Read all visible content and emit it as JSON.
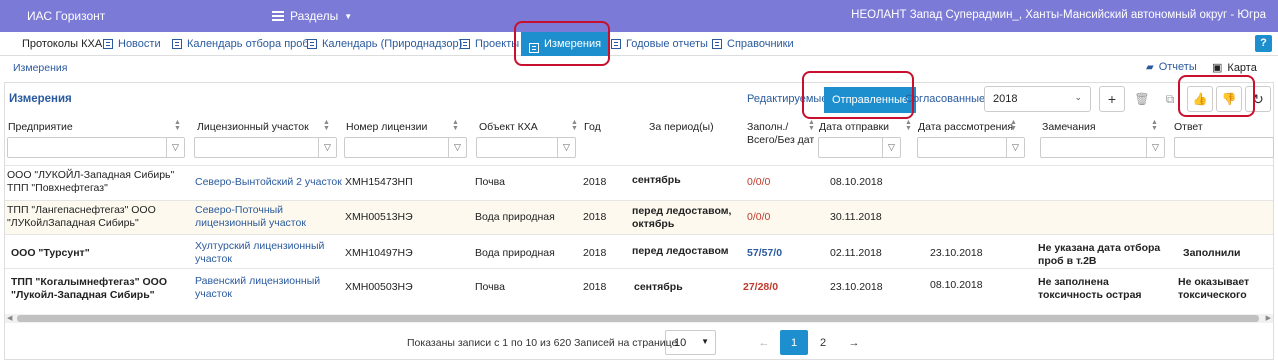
{
  "topbar": {
    "app_title": "ИАС Горизонт",
    "sections_label": "Разделы",
    "user": "НЕОЛАНТ Запад Суперадмин_, Ханты-Мансийский автономный округ - Югра"
  },
  "nav": {
    "items": [
      {
        "label": "Протоколы КХА"
      },
      {
        "label": "Новости"
      },
      {
        "label": "Календарь отбора проб"
      },
      {
        "label": "Календарь (Природнадзор)"
      },
      {
        "label": "Проекты"
      },
      {
        "label": "Измерения"
      },
      {
        "label": "Годовые отчеты"
      },
      {
        "label": "Справочники"
      }
    ],
    "help": "?"
  },
  "breadcrumb": "Измерения",
  "right_links": {
    "reports": "Отчеты",
    "map": "Карта"
  },
  "panel": {
    "title": "Измерения",
    "toggles": {
      "editable": "Редактируемые",
      "sent": "Отправленные",
      "approved": "Согласованные"
    },
    "year": "2018"
  },
  "columns": [
    "Предприятие",
    "Лицензионный участок",
    "Номер лицензии",
    "Объект КХА",
    "Год",
    "За период(ы)",
    "Заполн./Всего/Без дат",
    "Дата отправки",
    "Дата рассмотрения",
    "Замечания",
    "Ответ"
  ],
  "rows": [
    {
      "company": "ООО \"ЛУКОЙЛ-Западная Сибирь\" ТПП \"Повхнефтегаз\"",
      "area": "Северо-Вынтойский 2 участок",
      "license": "ХМН15473НП",
      "object": "Почва",
      "year": "2018",
      "period": "сентябрь",
      "filled": "0/0/0",
      "sent": "08.10.2018",
      "reviewed": "",
      "remarks": "",
      "answer": ""
    },
    {
      "company": "ТПП \"Лангепаснефтегаз\" ООО \"ЛУКойлЗападная Сибирь\"",
      "area": "Северо-Поточный лицензионный участок",
      "license": "ХМН00513НЭ",
      "object": "Вода природная",
      "year": "2018",
      "period": "перед ледоставом, октябрь",
      "filled": "0/0/0",
      "sent": "30.11.2018",
      "reviewed": "",
      "remarks": "",
      "answer": ""
    },
    {
      "company": "ООО \"Турсунт\"",
      "area": "Хултурский лицензионный участок",
      "license": "ХМН10497НЭ",
      "object": "Вода природная",
      "year": "2018",
      "period": "перед ледоставом",
      "filled": "57/57/0",
      "sent": "02.11.2018",
      "reviewed": "23.10.2018",
      "remarks": "Не указана дата отбора проб в т.2В",
      "answer": "Заполнили"
    },
    {
      "company": "ТПП \"Когалымнефтегаз\" ООО \"Лукойл-Западная Сибирь\"",
      "area": "Равенский лицензионный участок",
      "license": "ХМН00503НЭ",
      "object": "Почва",
      "year": "2018",
      "period": "сентябрь",
      "filled": "27/28/0",
      "sent": "23.10.2018",
      "reviewed": "08.10.2018",
      "remarks": "Не заполнена токсичность острая",
      "answer": "Не оказывает токсического воздей"
    }
  ],
  "pager": {
    "summary": "Показаны записи с 1 по 10 из 620",
    "per_page_label": "Записей на странице",
    "per_page": "10",
    "prev": "←",
    "pages": [
      "1",
      "2"
    ],
    "next": "→"
  },
  "colors": {
    "topbar": "#7b7ad6",
    "accent": "#1e8fce",
    "highlight": "#c8102e",
    "link": "#2a5a9e"
  }
}
